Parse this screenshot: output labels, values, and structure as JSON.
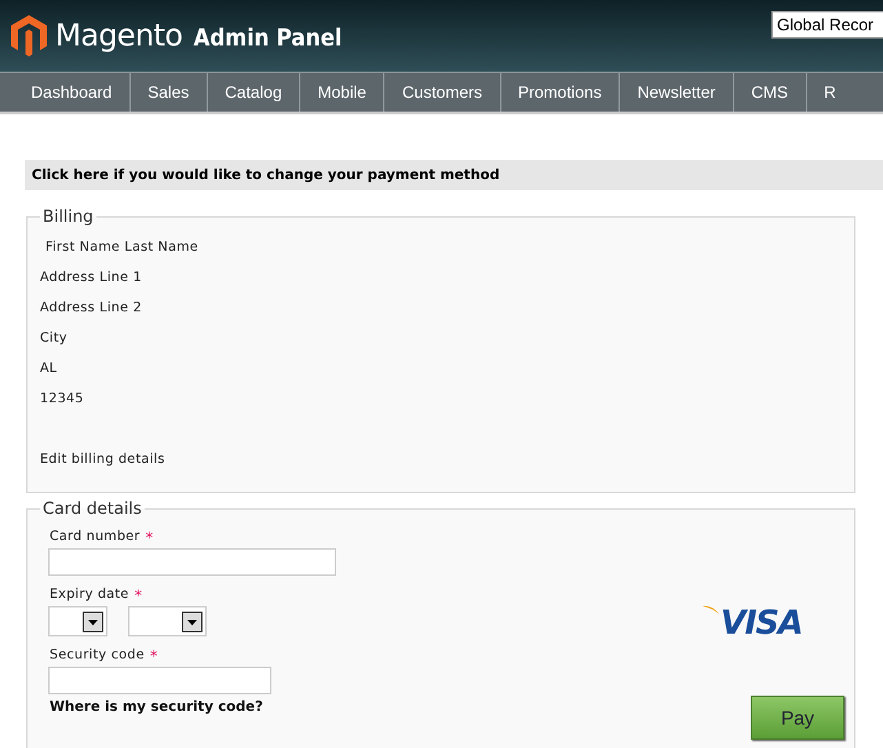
{
  "header": {
    "brand": "Magento",
    "brand_suffix": "Admin Panel",
    "search": {
      "value": "Global Recor"
    }
  },
  "nav": {
    "items": [
      {
        "label": "Dashboard"
      },
      {
        "label": "Sales"
      },
      {
        "label": "Catalog"
      },
      {
        "label": "Mobile"
      },
      {
        "label": "Customers"
      },
      {
        "label": "Promotions"
      },
      {
        "label": "Newsletter"
      },
      {
        "label": "CMS"
      },
      {
        "label": "R"
      }
    ]
  },
  "payment_change_link": "Click here if you would like to change your payment method",
  "billing": {
    "legend": "Billing",
    "lines": [
      "First Name Last Name",
      "Address Line 1",
      "Address Line 2",
      "City",
      "AL",
      "12345"
    ],
    "edit_link": "Edit billing details"
  },
  "card": {
    "legend": "Card details",
    "fields": [
      {
        "kind": "text",
        "label": "Card number",
        "required_mark": "*"
      },
      {
        "kind": "selects",
        "label": "Expiry date",
        "required_mark": "*"
      },
      {
        "kind": "text_short",
        "label": "Security code",
        "required_mark": "*"
      }
    ],
    "help_link": "Where is my security code?",
    "card_brand": "VISA",
    "pay_button": "Pay"
  }
}
